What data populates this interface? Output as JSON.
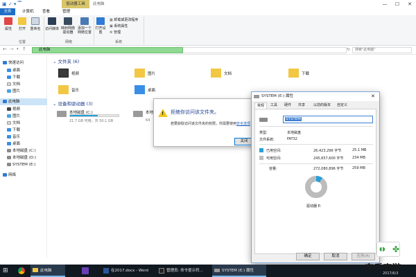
{
  "titlebar": {
    "drive_tools_tab": "驱动器工具",
    "title": "此电脑",
    "min": "—",
    "max": "☐",
    "close": "✕"
  },
  "ribbon_tabs": {
    "file": "文件",
    "computer": "计算机",
    "view": "查看",
    "manage": "管理"
  },
  "ribbon": {
    "properties": "属性",
    "open": "打开",
    "rename": "重命名",
    "access_media": "访问媒体",
    "map_drive": "映射网络驱动器",
    "add_location": "添加一个网络位置",
    "open_settings": "打开设置",
    "uninstall": "卸载或更改程序",
    "system_props": "系统属性",
    "manage": "管理",
    "group_location": "位置",
    "group_network": "网络",
    "group_system": "系统"
  },
  "address": {
    "path": "此电脑",
    "search_placeholder": "搜索\"此电脑\""
  },
  "nav": {
    "quick_access": "快速访问",
    "items": [
      "桌面",
      "下载",
      "文档",
      "图片"
    ],
    "this_pc": "此电脑",
    "pc_items": [
      "视频",
      "图片",
      "文档",
      "下载",
      "音乐",
      "桌面",
      "本地磁盘 (C:)",
      "本地磁盘 (D:)",
      "SYSTEM (E:)"
    ],
    "network": "网络"
  },
  "content": {
    "folders_header": "文件夹 (6)",
    "folders": [
      "视频",
      "图片",
      "文档",
      "下载",
      "音乐",
      "桌面"
    ],
    "drives_header": "设备和驱动器 (3)",
    "drive_c_name": "本地磁盘 (C:)",
    "drive_c_free": "21.7 GB 可用，共 50.1 GB",
    "drive_c_used_fraction": 0.57,
    "drive_d_name": "本地",
    "drive_d_free": "64"
  },
  "error_dialog": {
    "title": "拒绝你访问该文件夹。",
    "message": "若要获取访问该文件夹的权限，你需要使用",
    "link": "安全选项",
    "close": "关闭"
  },
  "props": {
    "title": "SYSTEM (E:) 属性",
    "tabs": [
      "常规",
      "工具",
      "硬件",
      "共享",
      "以前的版本",
      "自定义"
    ],
    "label_value": "SYSTEM",
    "type_label": "类型:",
    "type_value": "本地磁盘",
    "fs_label": "文件系统:",
    "fs_value": "FAT32",
    "used_label": "已用空间:",
    "used_bytes": "26,423,296 字节",
    "used_size": "25.1 MB",
    "free_label": "可用空间:",
    "free_bytes": "245,657,600 字节",
    "free_size": "234 MB",
    "cap_label": "容量:",
    "cap_bytes": "272,080,896 字节",
    "cap_size": "259 MB",
    "drive_label": "驱动器 E:",
    "used_fraction": 0.097,
    "ok": "确定",
    "cancel": "取消",
    "apply": "应用(A)",
    "colors": {
      "used": "#26a0da",
      "free": "#bcbcbc"
    }
  },
  "taskbar": {
    "items": [
      "此电脑",
      "在2017.docx - Word",
      "管理员: 命令提示符...",
      "SYSTEM (E:) 属性"
    ],
    "date": "2017/6/3"
  },
  "watermark": "东手宇游"
}
